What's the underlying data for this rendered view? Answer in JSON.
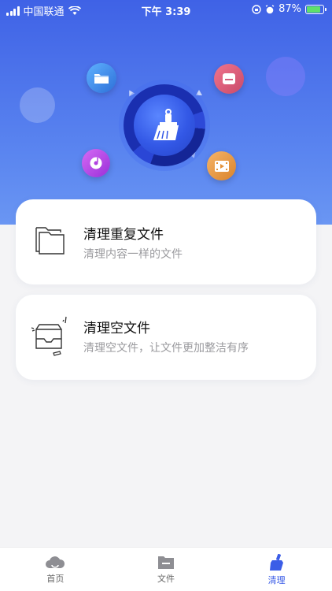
{
  "status_bar": {
    "carrier": "中国联通",
    "time": "下午 3:39",
    "battery": "87%",
    "battery_level": 0.87,
    "icons": [
      "signal-icon",
      "wifi-icon",
      "orientation-lock-icon",
      "alarm-icon",
      "battery-icon"
    ]
  },
  "hero": {
    "center_icon": "broom-icon",
    "orbit_icons": [
      "folder-icon",
      "document-icon",
      "music-disc-icon",
      "video-icon"
    ]
  },
  "cards": [
    {
      "title": "清理重复文件",
      "description": "清理内容一样的文件",
      "icon": "duplicate-folders-icon"
    },
    {
      "title": "清理空文件",
      "description": "清理空文件，让文件更加整洁有序",
      "icon": "empty-tray-icon"
    }
  ],
  "tabbar": {
    "tabs": [
      {
        "label": "首页",
        "icon": "home-cloud-icon",
        "active": false
      },
      {
        "label": "文件",
        "icon": "file-folder-icon",
        "active": false
      },
      {
        "label": "清理",
        "icon": "broom-icon",
        "active": true
      }
    ]
  },
  "colors": {
    "accent": "#3b5de7",
    "hero_top": "#3f62e6",
    "hero_bottom": "#6a96f3",
    "background": "#f4f4f6"
  }
}
